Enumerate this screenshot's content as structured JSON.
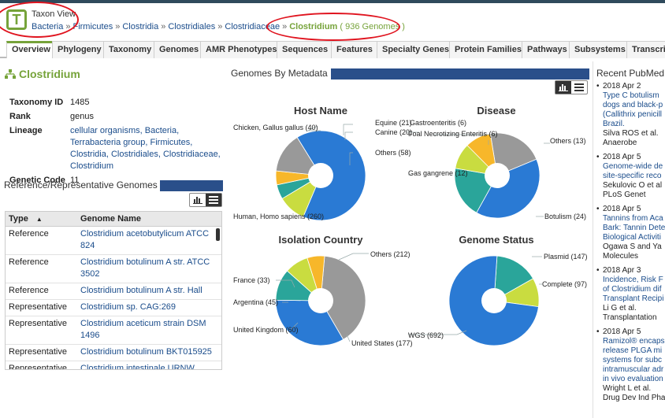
{
  "header": {
    "view_title": "Taxon View",
    "logo_letter": "T",
    "breadcrumb": [
      "Bacteria",
      "Firmicutes",
      "Clostridia",
      "Clostridiales",
      "Clostridiaceae"
    ],
    "breadcrumb_sep": "»",
    "current": "Clostridium",
    "genome_count": "( 936 Genomes )"
  },
  "tabs": [
    "Overview",
    "Phylogeny",
    "Taxonomy",
    "Genomes",
    "AMR Phenotypes",
    "Sequences",
    "Features",
    "Specialty Genes",
    "Protein Families",
    "Pathways",
    "Subsystems",
    "Transcript"
  ],
  "organism": {
    "name": "Clostridium",
    "rows": [
      {
        "key": "Taxonomy ID",
        "value": "1485"
      },
      {
        "key": "Rank",
        "value": "genus"
      },
      {
        "key": "Lineage",
        "value": "cellular organisms, Bacteria, Terrabacteria group, Firmicutes, Clostridia, Clostridiales, Clostridiaceae, Clostridium"
      },
      {
        "key": "Genetic Code",
        "value": "11"
      }
    ]
  },
  "ref_genomes": {
    "title": "Reference/Representative Genomes",
    "col_type": "Type",
    "col_name": "Genome Name",
    "rows": [
      {
        "type": "Reference",
        "name": "Clostridium acetobutylicum ATCC 824"
      },
      {
        "type": "Reference",
        "name": "Clostridium botulinum A str. ATCC 3502"
      },
      {
        "type": "Reference",
        "name": "Clostridium botulinum A str. Hall"
      },
      {
        "type": "Representative",
        "name": "Clostridium sp. CAG:269"
      },
      {
        "type": "Representative",
        "name": "Clostridium aceticum strain DSM 1496"
      },
      {
        "type": "Representative",
        "name": "Clostridium botulinum BKT015925"
      },
      {
        "type": "Representative",
        "name": "Clostridium intestinale URNW"
      }
    ]
  },
  "metadata": {
    "title": "Genomes By Metadata"
  },
  "chart_data": [
    {
      "type": "pie",
      "title": "Host Name",
      "categories": [
        "Human, Homo sapiens",
        "Chicken, Gallus gallus",
        "Equine",
        "Canine",
        "Others"
      ],
      "values": [
        260,
        40,
        21,
        20,
        58
      ],
      "colors": [
        "#2a7ad4",
        "#c9dc40",
        "#2aa59a",
        "#f7b72a",
        "#999999"
      ]
    },
    {
      "type": "pie",
      "title": "Disease",
      "categories": [
        "Botulism",
        "Gas gangrene",
        "Gastroenteritis",
        "Foal Necrotizing Enteritis",
        "Others"
      ],
      "values": [
        24,
        12,
        6,
        6,
        13
      ],
      "colors": [
        "#2a7ad4",
        "#2aa59a",
        "#f7b72a",
        "#c9dc40",
        "#999999"
      ]
    },
    {
      "type": "pie",
      "title": "Isolation Country",
      "categories": [
        "United States",
        "United Kingdom",
        "Argentina",
        "France",
        "Others"
      ],
      "values": [
        177,
        60,
        45,
        33,
        212
      ],
      "colors": [
        "#2a7ad4",
        "#2aa59a",
        "#c9dc40",
        "#f7b72a",
        "#999999"
      ]
    },
    {
      "type": "pie",
      "title": "Genome Status",
      "categories": [
        "WGS",
        "Complete",
        "Plasmid"
      ],
      "values": [
        692,
        97,
        147
      ],
      "colors": [
        "#2a7ad4",
        "#c9dc40",
        "#2aa59a"
      ]
    }
  ],
  "pie_labels": [
    {
      "text": "Chicken, Gallus gallus (40)"
    },
    {
      "text": "Equine (21)"
    },
    {
      "text": "Canine (20)"
    },
    {
      "text": "Others (58)"
    },
    {
      "text": "Human, Homo sapiens (260)"
    },
    {
      "text": "Gastroenteritis (6)"
    },
    {
      "text": "Foal Necrotizing Enteritis (6)"
    },
    {
      "text": "Others (13)"
    },
    {
      "text": "Gas gangrene (12)"
    },
    {
      "text": "Botulism (24)"
    },
    {
      "text": "Others (212)"
    },
    {
      "text": "France (33)"
    },
    {
      "text": "Argentina (45)"
    },
    {
      "text": "United Kingdom (60)"
    },
    {
      "text": "United States (177)"
    },
    {
      "text": "Plasmid (147)"
    },
    {
      "text": "Complete (97)"
    },
    {
      "text": "WGS (692)"
    }
  ],
  "pubmed": {
    "title": "Recent PubMed",
    "items": [
      {
        "date": "2018 Apr 2",
        "lines": [
          "Type C botulism",
          "dogs and black-p",
          "(Callithrix penicill",
          "Brazil."
        ],
        "authors": "Silva ROS et al.",
        "journal": "Anaerobe"
      },
      {
        "date": "2018 Apr 5",
        "lines": [
          "Genome-wide de",
          "site-specific reco"
        ],
        "authors": "Sekulovic O et al",
        "journal": "PLoS Genet"
      },
      {
        "date": "2018 Apr 5",
        "lines": [
          "Tannins from Aca",
          "Bark: Tannin Deter",
          "Biological Activiti"
        ],
        "authors": "Ogawa S and Ya",
        "journal": "Molecules"
      },
      {
        "date": "2018 Apr 3",
        "lines": [
          "Incidence, Risk F",
          "of Clostridium dif",
          "Transplant Recipi"
        ],
        "authors": "Li G et al.",
        "journal": "Transplantation"
      },
      {
        "date": "2018 Apr 5",
        "lines": [
          "Ramizol® encaps",
          "release PLGA mi",
          "systems for subc",
          "intramuscular adr",
          "in vivo evaluation"
        ],
        "authors": "Wright L et al.",
        "journal": "Drug Dev Ind Pha"
      }
    ]
  }
}
